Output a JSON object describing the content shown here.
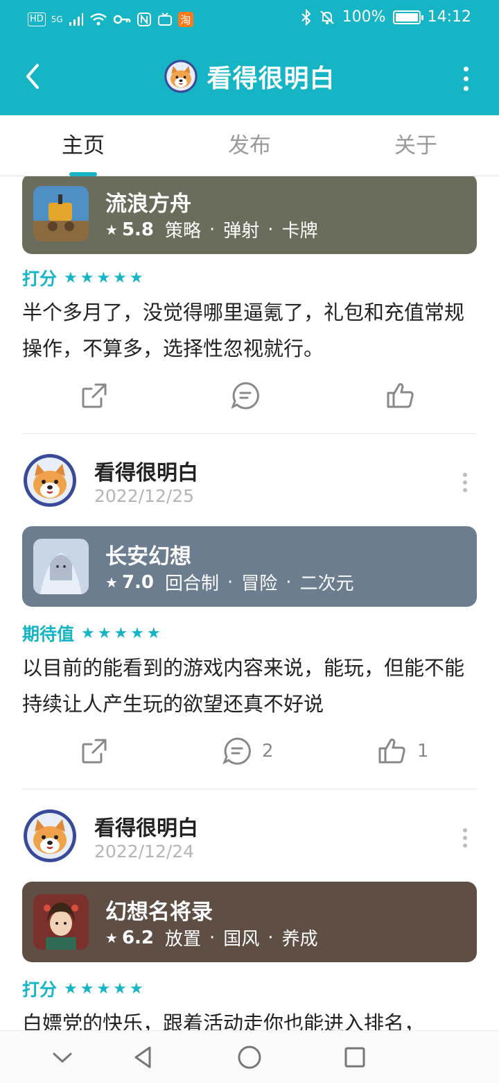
{
  "status_bar": {
    "left_icons": [
      "HD",
      "5G",
      "signal-icon",
      "wifi-icon",
      "key-icon",
      "nfc-icon",
      "tv-icon",
      "taobao-icon"
    ],
    "taobao_label": "淘",
    "hd_label": "HD",
    "net_label": "5G",
    "battery_pct": "100%",
    "time": "14:12"
  },
  "header": {
    "title": "看得很明白"
  },
  "tabs": [
    {
      "label": "主页",
      "active": true
    },
    {
      "label": "发布",
      "active": false
    },
    {
      "label": "关于",
      "active": false
    }
  ],
  "posts": [
    {
      "game": {
        "name": "流浪方舟",
        "score": "5.8",
        "tags": [
          "策略",
          "弹射",
          "卡牌"
        ],
        "bg": "#6a6d5b"
      },
      "rating_label": "打分",
      "review": "半个多月了，没觉得哪里逼氪了，礼包和充值常规操作，不算多，选择性忽视就行。",
      "comments": "",
      "likes": ""
    },
    {
      "author": "看得很明白",
      "date": "2022/12/25",
      "game": {
        "name": "长安幻想",
        "score": "7.0",
        "tags": [
          "回合制",
          "冒险",
          "二次元"
        ],
        "bg": "#6c7d8f"
      },
      "rating_label": "期待值",
      "review": "以目前的能看到的游戏内容来说，能玩，但能不能持续让人产生玩的欲望还真不好说",
      "comments": "2",
      "likes": "1"
    },
    {
      "author": "看得很明白",
      "date": "2022/12/24",
      "game": {
        "name": "幻想名将录",
        "score": "6.2",
        "tags": [
          "放置",
          "国风",
          "养成"
        ],
        "bg": "#5e4e44"
      },
      "rating_label": "打分",
      "review": "白嫖党的快乐，跟着活动走你也能进入排名，",
      "comments": "",
      "likes": ""
    }
  ],
  "stars": "★★★★★",
  "dot_sep": "·",
  "colors": {
    "accent": "#15b5c5",
    "text": "#222222",
    "muted": "#9a9a9a"
  }
}
